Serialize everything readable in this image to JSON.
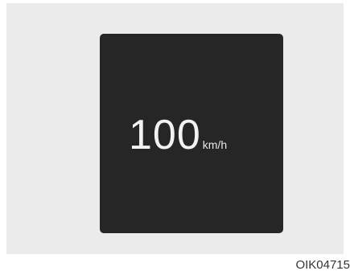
{
  "display": {
    "speed_value": "100",
    "speed_unit": "km/h"
  },
  "figure_code": "OIK04715",
  "colors": {
    "panel_background": "#ebebeb",
    "display_background": "#262626",
    "display_text": "#f2f2f2"
  }
}
